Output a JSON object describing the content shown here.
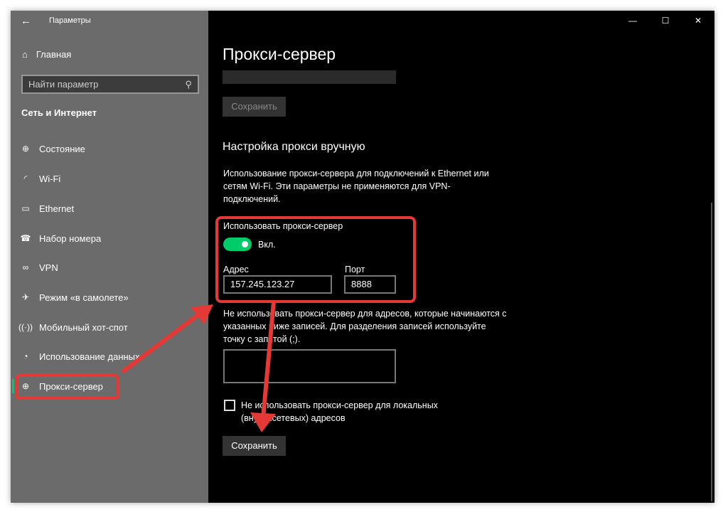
{
  "window": {
    "title": "Параметры",
    "back": "←",
    "minimize": "—",
    "maximize": "☐",
    "close": "✕"
  },
  "sidebar": {
    "home": "Главная",
    "search_placeholder": "Найти параметр",
    "section": "Сеть и Интернет",
    "items": [
      {
        "label": "Состояние",
        "icon": "⊕"
      },
      {
        "label": "Wi-Fi",
        "icon": "◜"
      },
      {
        "label": "Ethernet",
        "icon": "▭"
      },
      {
        "label": "Набор номера",
        "icon": "☎"
      },
      {
        "label": "VPN",
        "icon": "∞"
      },
      {
        "label": "Режим «в самолете»",
        "icon": "✈"
      },
      {
        "label": "Мобильный хот-спот",
        "icon": "((·))"
      },
      {
        "label": "Использование данных",
        "icon": "◔"
      },
      {
        "label": "Прокси-сервер",
        "icon": "⊕"
      }
    ]
  },
  "main": {
    "title": "Прокси-сервер",
    "save_top": "Сохранить",
    "manual_heading": "Настройка прокси вручную",
    "description": "Использование прокси-сервера для подключений к Ethernet или сетям Wi-Fi. Эти параметры не применяются для VPN-подключений.",
    "use_proxy_label": "Использовать прокси-сервер",
    "toggle_state": "Вкл.",
    "address_label": "Адрес",
    "address_value": "157.245.123.27",
    "port_label": "Порт",
    "port_value": "8888",
    "exceptions_text": "Не использовать прокси-сервер для адресов, которые начинаются с указанных ниже записей. Для разделения записей используйте точку с запятой (;).",
    "exceptions_value": "",
    "local_checkbox": "Не использовать прокси-сервер для локальных (внутрисетевых) адресов",
    "save_bottom": "Сохранить"
  },
  "colors": {
    "accent": "#00cc6a",
    "annotation": "#e53935",
    "sidebar": "#6b6b6b"
  }
}
